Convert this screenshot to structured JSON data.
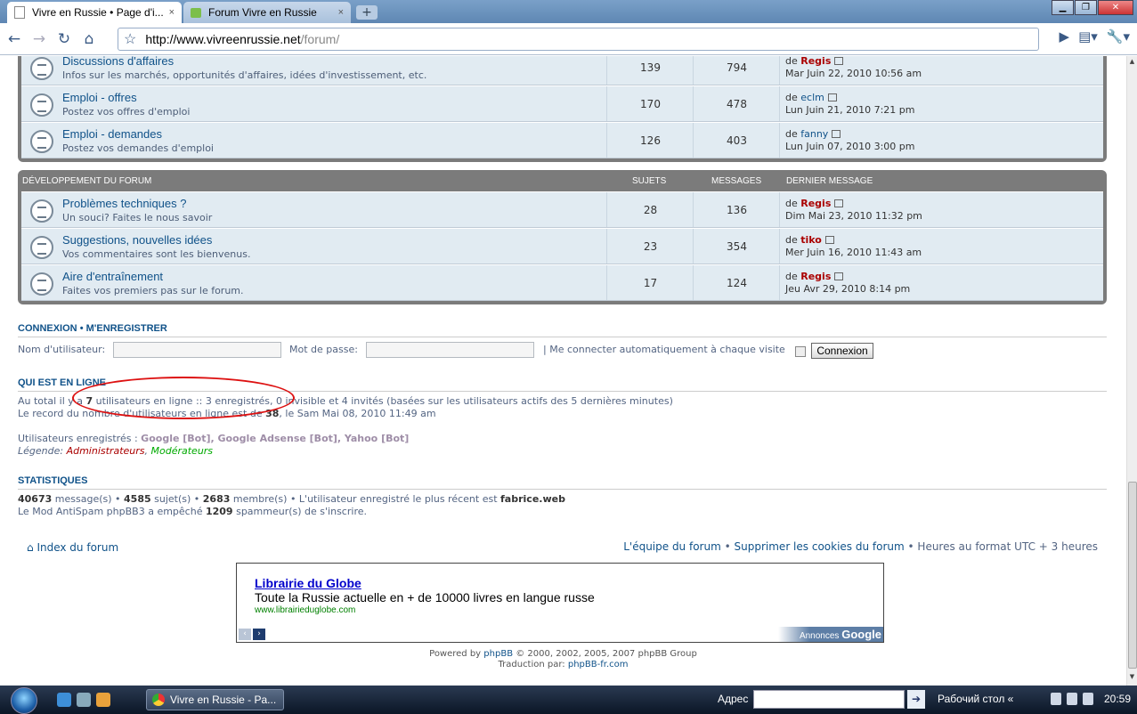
{
  "browser": {
    "tabs": [
      {
        "title": "Vivre en Russie • Page d'i...",
        "close": "×"
      },
      {
        "title": "Forum Vivre en Russie",
        "close": "×"
      }
    ],
    "new_tab": "+",
    "url_host": "http://www.vivreenrussie.net",
    "url_path": "/forum/"
  },
  "forum_block1": {
    "rows": [
      {
        "title": "Discussions d'affaires",
        "desc": "Infos sur les marchés, opportunités d'affaires, idées d'investissement, etc.",
        "topics": "139",
        "posts": "794",
        "by": "de",
        "user": "Regis",
        "user_color": "red",
        "date": "Mar Juin 22, 2010 10:56 am"
      },
      {
        "title": "Emploi - offres",
        "desc": "Postez vos offres d'emploi",
        "topics": "170",
        "posts": "478",
        "by": "de",
        "user": "eclm",
        "user_color": "blue",
        "date": "Lun Juin 21, 2010 7:21 pm"
      },
      {
        "title": "Emploi - demandes",
        "desc": "Postez vos demandes d'emploi",
        "topics": "126",
        "posts": "403",
        "by": "de",
        "user": "fanny",
        "user_color": "blue",
        "date": "Lun Juin 07, 2010 3:00 pm"
      }
    ]
  },
  "forum_block2": {
    "header": {
      "name": "Développement du forum",
      "topics": "Sujets",
      "posts": "Messages",
      "last": "Dernier message"
    },
    "rows": [
      {
        "title": "Problèmes techniques ?",
        "desc": "Un souci? Faites le nous savoir",
        "topics": "28",
        "posts": "136",
        "by": "de",
        "user": "Regis",
        "date": "Dim Mai 23, 2010 11:32 pm"
      },
      {
        "title": "Suggestions, nouvelles idées",
        "desc": "Vos commentaires sont les bienvenus.",
        "topics": "23",
        "posts": "354",
        "by": "de",
        "user": "tiko",
        "date": "Mer Juin 16, 2010 11:43 am"
      },
      {
        "title": "Aire d'entraînement",
        "desc": "Faites vos premiers pas sur le forum.",
        "topics": "17",
        "posts": "124",
        "by": "de",
        "user": "Regis",
        "date": "Jeu Avr 29, 2010 8:14 pm"
      }
    ]
  },
  "login": {
    "heading_login": "Connexion",
    "heading_sep": "•",
    "heading_register": "M'enregistrer",
    "username_label": "Nom d'utilisateur:",
    "password_label": "Mot de passe:",
    "auto_label": "| Me connecter automatiquement à chaque visite",
    "button": "Connexion"
  },
  "online": {
    "heading": "Qui est en ligne",
    "line1_a": "Au total il y a",
    "line1_count": "7",
    "line1_b": "utilisateurs en ligne :: 3 enregistrés, 0 invisible et 4 invités (basées sur les utilisateurs actifs des 5 dernières minutes)",
    "line2_a": "Le record du nombre d'utilisateurs en ligne est de",
    "line2_count": "38",
    "line2_b": ", le Sam Mai 08, 2010 11:49 am",
    "registered_label": "Utilisateurs enregistrés :",
    "registered_users": "Google [Bot], Google Adsense [Bot], Yahoo [Bot]",
    "legend_label": "Légende:",
    "legend_admin": "Administrateurs",
    "legend_sep": ",",
    "legend_mod": "Modérateurs"
  },
  "stats": {
    "heading": "Statistiques",
    "messages": "40673",
    "messages_label": "message(s) •",
    "topics": "4585",
    "topics_label": "sujet(s) •",
    "members": "2683",
    "members_label": "membre(s) • L'utilisateur enregistré le plus récent est",
    "newest": "fabrice.web",
    "antispam_a": "Le Mod AntiSpam phpBB3 a empêché",
    "antispam_count": "1209",
    "antispam_b": "spammeur(s) de s'inscrire."
  },
  "navbar": {
    "index": "Index du forum",
    "team": "L'équipe du forum",
    "sep": "•",
    "cookies": "Supprimer les cookies du forum",
    "timezone": "• Heures au format UTC + 3 heures"
  },
  "ad": {
    "title": "Librairie du Globe",
    "text": "Toute la Russie actuelle en + de 10000 livres en langue russe",
    "url": "www.librairieduglobe.com",
    "badge_a": "Annonces",
    "badge_b": "Google",
    "prev": "‹",
    "next": "›"
  },
  "footer": {
    "powered_a": "Powered by",
    "powered_link": "phpBB",
    "powered_b": "© 2000, 2002, 2005, 2007 phpBB Group",
    "trans_a": "Traduction par:",
    "trans_link": "phpBB-fr.com"
  },
  "taskbar": {
    "window": "Vivre en Russie - Pa...",
    "address_label": "Адрес",
    "desktop": "Рабочий стол",
    "chevron": "«",
    "clock": "20:59"
  },
  "colors": {
    "accent": "#105289",
    "admin": "#aa0000",
    "moderator": "#00aa00",
    "annotation": "#dd1111"
  }
}
